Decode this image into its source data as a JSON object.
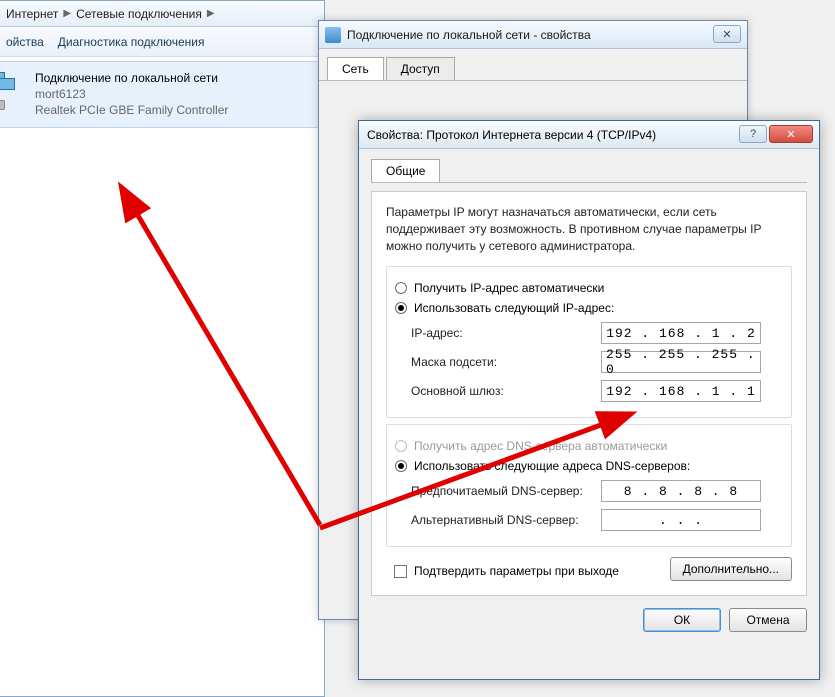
{
  "explorer": {
    "breadcrumb": {
      "item1": "Интернет",
      "item2": "Сетевые подключения"
    },
    "toolbar": {
      "item1": "ойства",
      "item2": "Диагностика подключения"
    },
    "connection": {
      "title": "Подключение по локальной сети",
      "user": "mort6123",
      "adapter": "Realtek PCIe GBE Family Controller"
    }
  },
  "propsWindow": {
    "title": "Подключение по локальной сети - свойства",
    "tabs": {
      "t1": "Сеть",
      "t2": "Доступ"
    }
  },
  "ipv4": {
    "title": "Свойства: Протокол Интернета версии 4 (TCP/IPv4)",
    "tab": "Общие",
    "description": "Параметры IP могут назначаться автоматически, если сеть поддерживает эту возможность. В противном случае параметры IP можно получить у сетевого администратора.",
    "radioAutoIp": "Получить IP-адрес автоматически",
    "radioManualIp": "Использовать следующий IP-адрес:",
    "lblIp": "IP-адрес:",
    "valIp": "192 . 168 .  1  .  2",
    "lblMask": "Маска подсети:",
    "valMask": "255 . 255 . 255 .  0",
    "lblGateway": "Основной шлюз:",
    "valGateway": "192 . 168 .  1  .  1",
    "radioAutoDns": "Получить адрес DNS-сервера автоматически",
    "radioManualDns": "Использовать следующие адреса DNS-серверов:",
    "lblDns1": "Предпочитаемый DNS-сервер:",
    "valDns1": " 8  .  8  .  8  .  8",
    "lblDns2": "Альтернативный DNS-сервер:",
    "valDns2": "    .     .     .    ",
    "chkValidate": "Подтвердить параметры при выходе",
    "btnAdvanced": "Дополнительно...",
    "btnOk": "ОК",
    "btnCancel": "Отмена"
  }
}
